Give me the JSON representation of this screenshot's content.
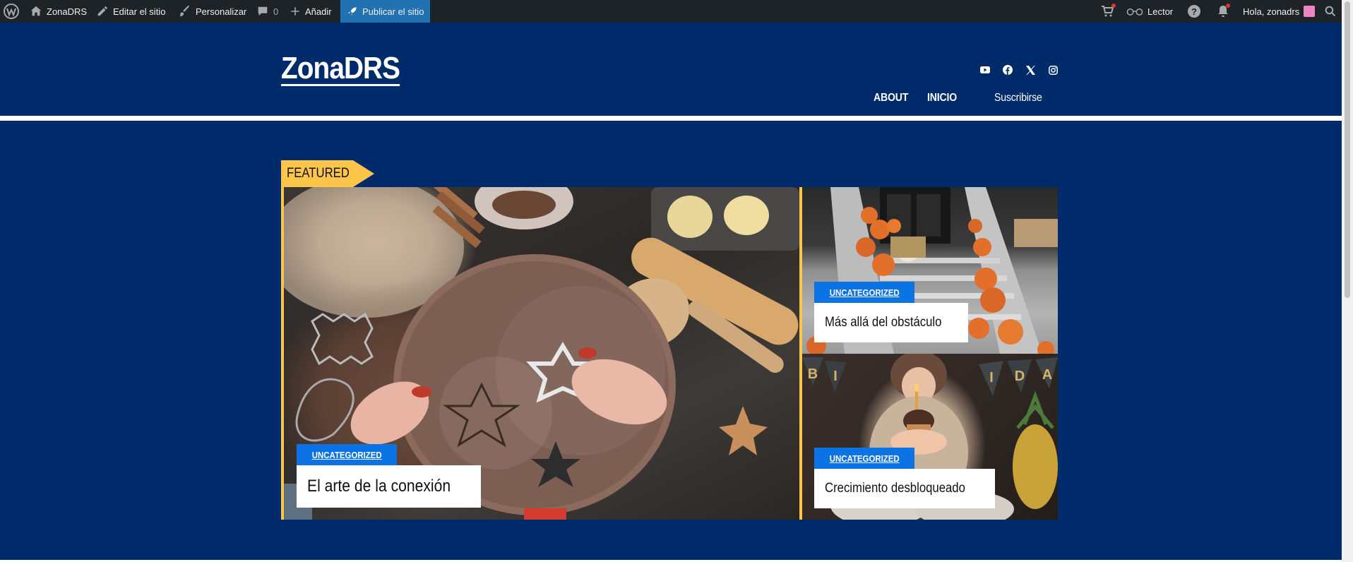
{
  "adminbar": {
    "site_name": "ZonaDRS",
    "edit_site": "Editar el sitio",
    "customize": "Personalizar",
    "comments_count": "0",
    "add_new": "Añadir",
    "publish_site": "Publicar el sitio",
    "reader": "Lector",
    "greeting": "Hola, zonadrs",
    "icons": [
      "wordpress-logo-icon",
      "home-icon",
      "pencil-icon",
      "brush-icon",
      "comment-icon",
      "plus-icon",
      "rocket-icon",
      "cart-icon",
      "glasses-icon",
      "help-icon",
      "bell-icon",
      "avatar",
      "search-icon"
    ]
  },
  "header": {
    "site_title": "ZonaDRS",
    "social": [
      "youtube-icon",
      "facebook-icon",
      "x-icon",
      "instagram-icon"
    ],
    "nav": [
      "ABOUT",
      "INICIO"
    ],
    "subscribe": "Suscribirse"
  },
  "featured": {
    "label": "FEATURED",
    "posts": [
      {
        "category": "UNCATEGORIZED",
        "title": "El arte de la conexión"
      },
      {
        "category": "UNCATEGORIZED",
        "title": "Más allá del obstáculo"
      },
      {
        "category": "UNCATEGORIZED",
        "title": "Crecimiento desbloqueado"
      }
    ]
  },
  "colors": {
    "adminbar_bg": "#1d2327",
    "site_bg": "#002b6b",
    "accent_yellow": "#fdc54a",
    "category_blue": "#0b73e3",
    "publish_blue": "#2271b1"
  }
}
